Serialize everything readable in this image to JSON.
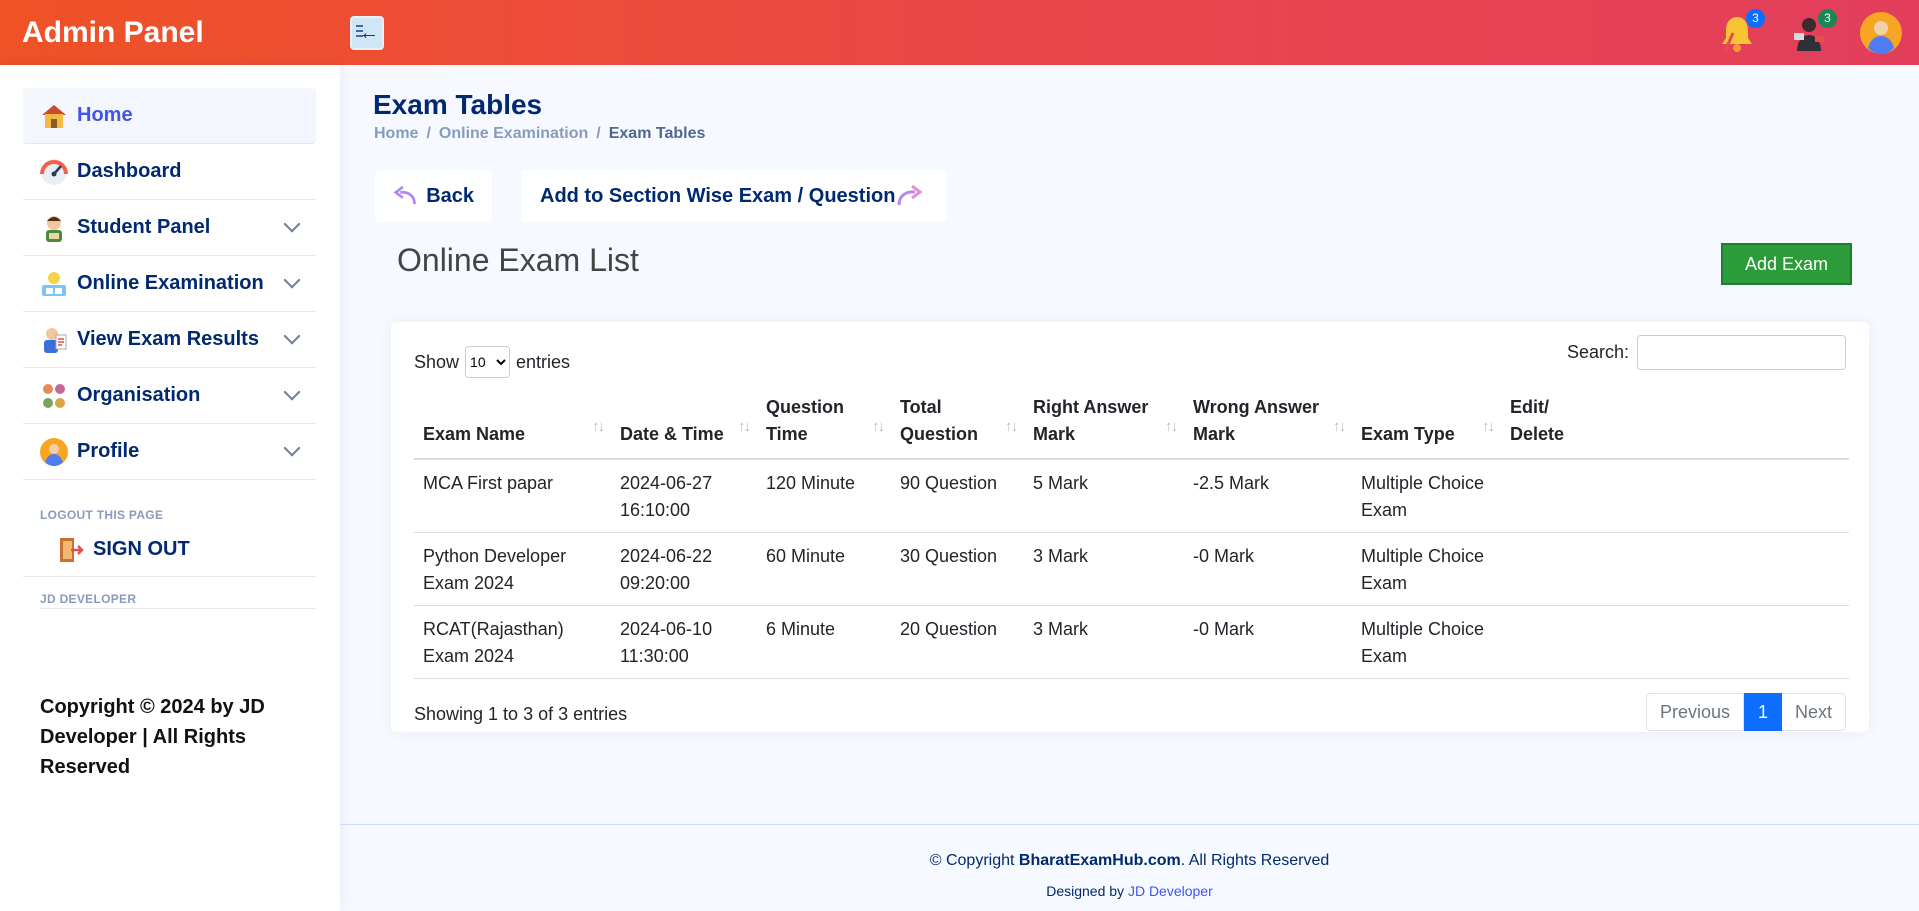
{
  "header": {
    "logo": "Admin Panel",
    "notifications_count": "3",
    "messages_count": "3",
    "colors": {
      "gradient_start": "#ef5226",
      "gradient_end": "#e23e5c"
    }
  },
  "sidebar": {
    "items": [
      {
        "label": "Home",
        "icon": "home-icon"
      },
      {
        "label": "Dashboard",
        "icon": "dashboard-icon"
      },
      {
        "label": "Student Panel",
        "icon": "student-icon"
      },
      {
        "label": "Online Examination",
        "icon": "exam-icon"
      },
      {
        "label": "View Exam Results",
        "icon": "results-icon"
      },
      {
        "label": "Organisation",
        "icon": "organisation-icon"
      },
      {
        "label": "Profile",
        "icon": "profile-icon"
      }
    ],
    "logout_heading": "LOGOUT THIS PAGE",
    "signout_label": "SIGN OUT",
    "developer_heading": "JD DEVELOPER",
    "copyright": "Copyright © 2024 by JD Developer | All Rights Reserved"
  },
  "page": {
    "title": "Exam Tables",
    "breadcrumb": [
      "Home",
      "Online Examination",
      "Exam Tables"
    ],
    "back_label": "Back",
    "add_section_label": "Add to Section Wise Exam / Question",
    "section_title": "Online Exam List",
    "add_exam_label": "Add Exam"
  },
  "table": {
    "show_label": "Show",
    "entries_value": "10",
    "entries_label": "entries",
    "search_label": "Search:",
    "columns": [
      "Exam Name",
      "Date & Time",
      "Question Time",
      "Total Question",
      "Right Answer Mark",
      "Wrong Answer Mark",
      "Exam Type",
      "Edit/ Delete"
    ],
    "rows": [
      [
        "MCA First papar",
        "2024-06-27 16:10:00",
        "120 Minute",
        "90 Question",
        "5 Mark",
        "-2.5 Mark",
        "Multiple Choice Exam",
        ""
      ],
      [
        "Python Developer Exam 2024",
        "2024-06-22 09:20:00",
        "60 Minute",
        "30 Question",
        "3 Mark",
        "-0 Mark",
        "Multiple Choice Exam",
        ""
      ],
      [
        "RCAT(Rajasthan) Exam 2024",
        "2024-06-10 11:30:00",
        "6 Minute",
        "20 Question",
        "3 Mark",
        "-0 Mark",
        "Multiple Choice Exam",
        ""
      ]
    ],
    "info": "Showing 1 to 3 of 3 entries",
    "pager": {
      "previous": "Previous",
      "current": "1",
      "next": "Next"
    }
  },
  "footer": {
    "copyright_prefix": "© Copyright",
    "brand": "BharatExamHub.com",
    "copyright_suffix": ". All Rights Reserved",
    "designed_prefix": "Designed by",
    "designer": "JD Developer"
  }
}
